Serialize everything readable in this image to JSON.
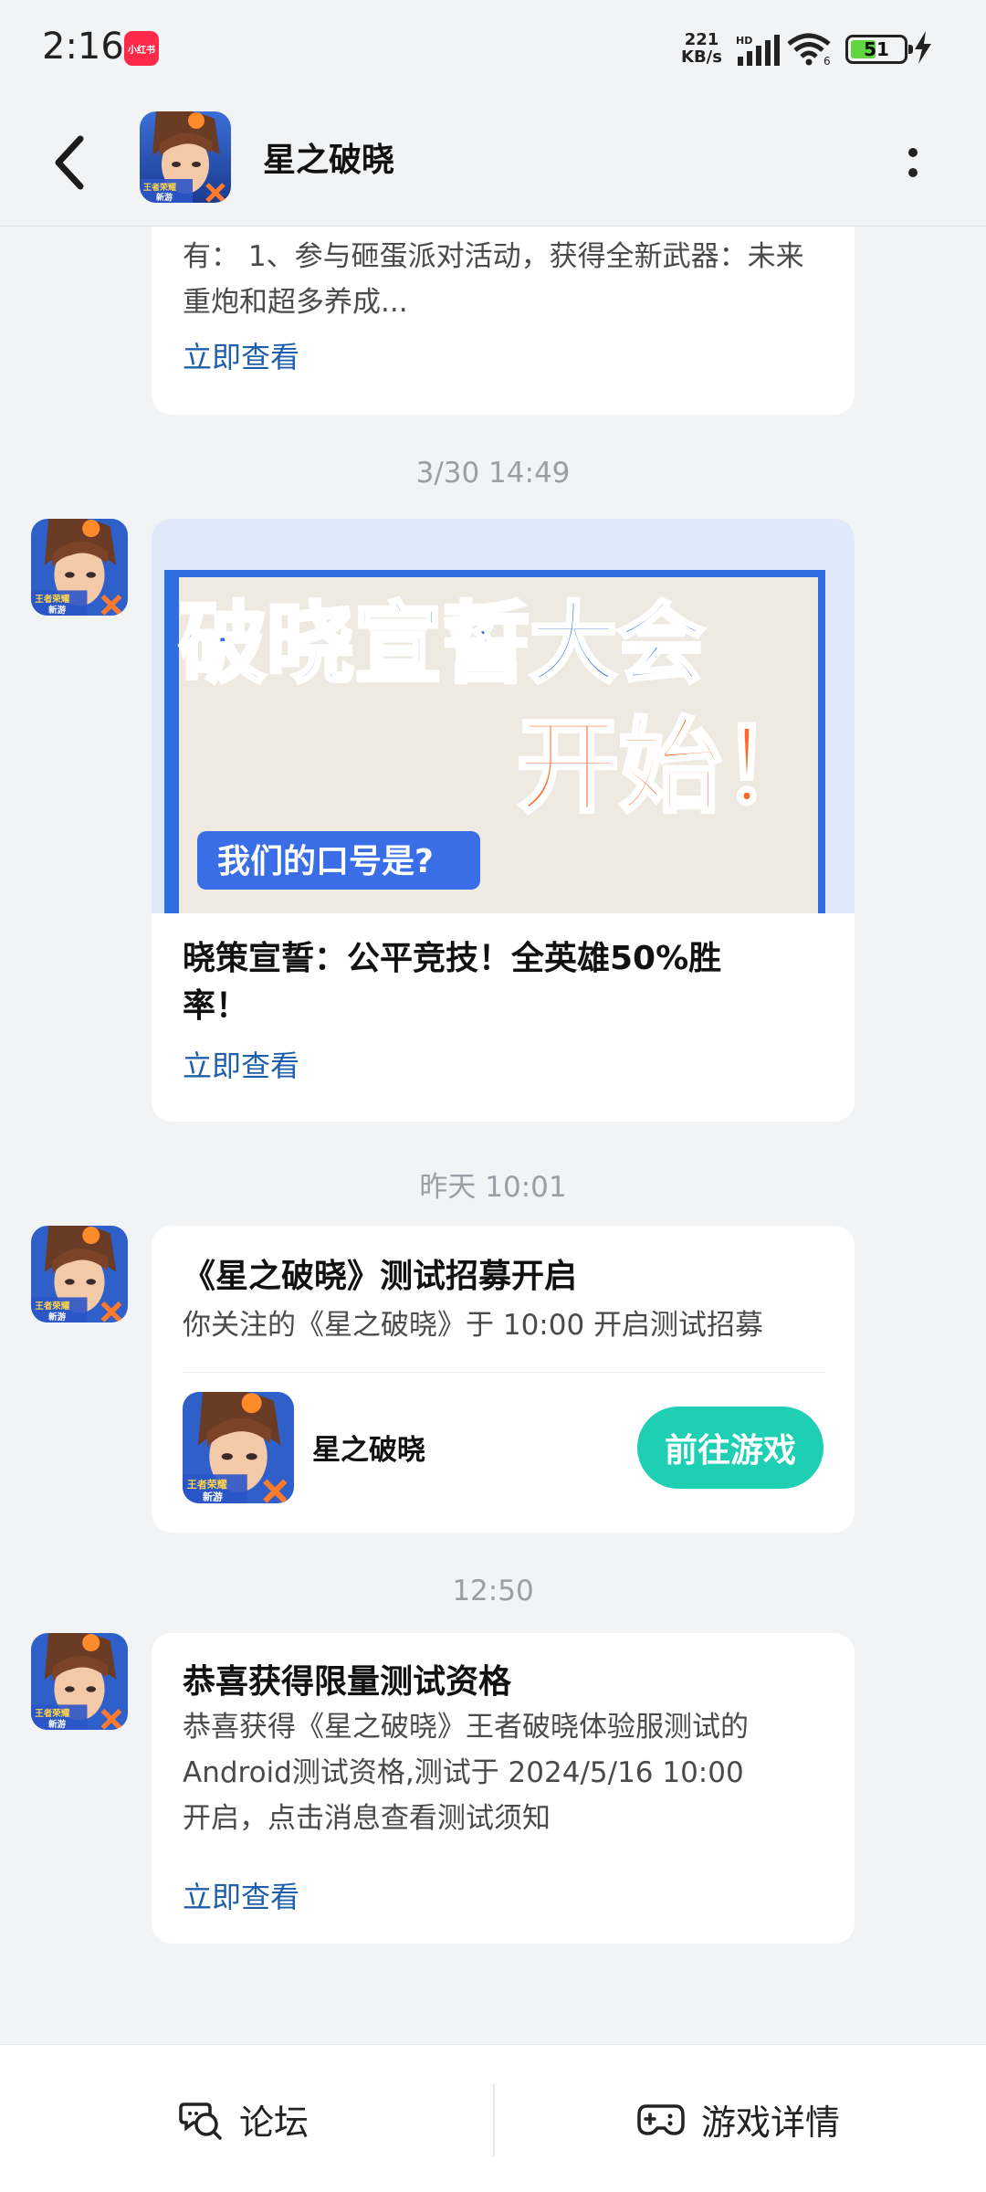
{
  "status_bar": {
    "time": "2:16",
    "app_badge": "小红书",
    "net_speed_value": "221",
    "net_speed_unit": "KB/s",
    "signal_label": "HD",
    "wifi_label": "6",
    "battery_level": "51"
  },
  "header": {
    "title": "星之破晓"
  },
  "messages": [
    {
      "partial": true,
      "text": "有：  1、参与砸蛋派对活动，获得全新武器：未来重炮和超多养成...",
      "link": "立即查看"
    },
    {
      "timestamp": "3/30  14:49",
      "banner": {
        "line1": "破晓宣誓大会",
        "line2": "开始！",
        "tag": "我们的口号是?"
      },
      "title": "晓策宣誓：公平竞技！全英雄50%胜率！",
      "link": "立即查看"
    },
    {
      "timestamp": "昨天  10:01",
      "title": "《星之破晓》测试招募开启",
      "text": "你关注的《星之破晓》于 10:00 开启测试招募",
      "game_name": "星之破晓",
      "button": "前往游戏"
    },
    {
      "timestamp": "12:50",
      "title": "恭喜获得限量测试资格",
      "text": "恭喜获得《星之破晓》王者破晓体验服测试的Android测试资格,测试于 2024/5/16 10:00 开启，点击消息查看测试须知",
      "link": "立即查看"
    }
  ],
  "avatar_badge": {
    "line1": "王者荣耀",
    "line2": "新游"
  },
  "bottom_bar": {
    "forum": "论坛",
    "game_detail": "游戏详情"
  },
  "colors": {
    "accent_link": "#1f5fa8",
    "go_button": "#1fcfb4",
    "background": "#f2f3f5"
  }
}
